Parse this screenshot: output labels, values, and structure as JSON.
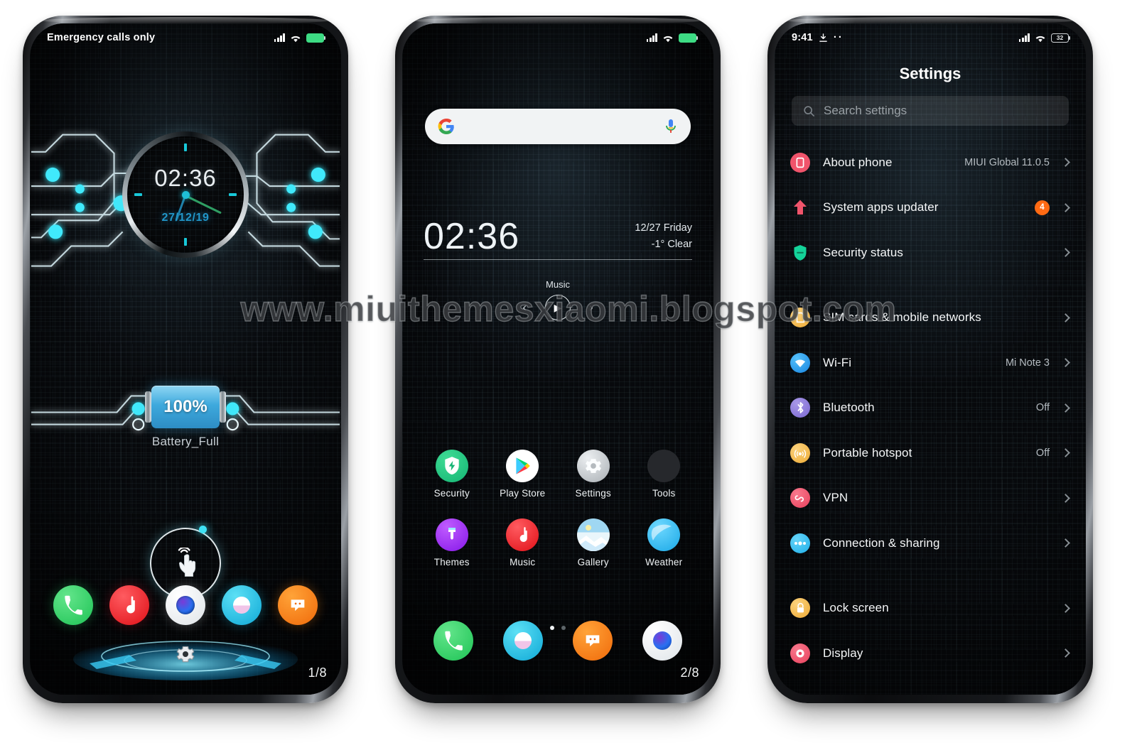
{
  "watermark": "www.miuithemesxiaomi.blogspot.com",
  "phone1": {
    "name": "lock-screen",
    "status": {
      "carrier": "Emergency calls only"
    },
    "clock": {
      "time": "02:36",
      "date": "27/12/19"
    },
    "battery_widget": {
      "value": "100%",
      "label": "Battery_Full"
    },
    "unlock_hint_icon": "tap-hand-icon",
    "dock": [
      {
        "label": "Phone",
        "icon": "phone-icon",
        "color": "#2fcf62"
      },
      {
        "label": "Music",
        "icon": "music-note-icon",
        "color": "#ee1d25"
      },
      {
        "label": "Camera",
        "icon": "camera-lens-icon",
        "color": "#ffffff"
      },
      {
        "label": "Mi Browser",
        "icon": "browser-icon",
        "color": "#23c4e8"
      },
      {
        "label": "Messages",
        "icon": "message-icon",
        "color": "#f57c1f"
      }
    ],
    "settings_gear_icon": "gear-icon",
    "page": "1/8"
  },
  "phone2": {
    "name": "home-screen",
    "search": {
      "placeholder": "",
      "left_icon": "google-g-icon",
      "right_icon": "microphone-icon"
    },
    "clock": {
      "time": "02:36",
      "date": "12/27  Friday",
      "weather": "-1° Clear"
    },
    "music": {
      "title": "Music",
      "prev_icon": "chevron-left-icon",
      "play_icon": "play-icon",
      "next_icon": "chevron-right-icon"
    },
    "apps": [
      {
        "label": "Security",
        "icon": "shield-bolt-icon",
        "color": "#1fc07a"
      },
      {
        "label": "Play Store",
        "icon": "play-store-icon",
        "color": "#ffffff"
      },
      {
        "label": "Settings",
        "icon": "gear-icon",
        "color": "#c8ccd0"
      },
      {
        "label": "Tools",
        "icon": "folder-grid-icon",
        "color": "#1a1c1f"
      },
      {
        "label": "Themes",
        "icon": "paintbrush-icon",
        "color": "#9b2ff5"
      },
      {
        "label": "Music",
        "icon": "music-note-icon",
        "color": "#ee1d25"
      },
      {
        "label": "Gallery",
        "icon": "landscape-icon",
        "color": "#bfe3f5"
      },
      {
        "label": "Weather",
        "icon": "weather-icon",
        "color": "#39c0ef"
      }
    ],
    "page_dots": {
      "count": 2,
      "active": 0
    },
    "dock": [
      {
        "label": "Phone",
        "icon": "phone-icon",
        "color": "#2fcf62"
      },
      {
        "label": "Mi Browser",
        "icon": "browser-icon",
        "color": "#23c4e8"
      },
      {
        "label": "Messages",
        "icon": "message-icon",
        "color": "#f57c1f"
      },
      {
        "label": "Camera",
        "icon": "camera-lens-icon",
        "color": "#ffffff"
      }
    ],
    "page": "2/8"
  },
  "phone3": {
    "name": "settings-screen",
    "status": {
      "time": "9:41",
      "download_icon": "download-icon",
      "dots_icon": "more-dots-icon",
      "battery": "32"
    },
    "title": "Settings",
    "search": {
      "placeholder": "Search settings",
      "icon": "search-icon"
    },
    "items": [
      {
        "label": "About phone",
        "value": "MIUI Global 11.0.5",
        "badge": "",
        "icon": "phone-outline-icon",
        "color": "#f0546b"
      },
      {
        "label": "System apps updater",
        "value": "",
        "badge": "4",
        "icon": "up-arrow-icon",
        "color": "#f0546b"
      },
      {
        "label": "Security status",
        "value": "",
        "badge": "",
        "icon": "shield-icon",
        "color": "#14d39a"
      },
      {
        "gap": true
      },
      {
        "label": "SIM cards & mobile networks",
        "value": "",
        "badge": "",
        "icon": "sim-card-icon",
        "color": "#f5b942"
      },
      {
        "label": "Wi-Fi",
        "value": "Mi Note 3",
        "badge": "",
        "icon": "wifi-icon",
        "color": "#2196f3"
      },
      {
        "label": "Bluetooth",
        "value": "Off",
        "badge": "",
        "icon": "bluetooth-icon",
        "color": "#8e7cdc"
      },
      {
        "label": "Portable hotspot",
        "value": "Off",
        "badge": "",
        "icon": "hotspot-icon",
        "color": "#f5b942"
      },
      {
        "label": "VPN",
        "value": "",
        "badge": "",
        "icon": "vpn-icon",
        "color": "#f0546b"
      },
      {
        "label": "Connection & sharing",
        "value": "",
        "badge": "",
        "icon": "connection-icon",
        "color": "#2bb7f0"
      },
      {
        "gap": true
      },
      {
        "label": "Lock screen",
        "value": "",
        "badge": "",
        "icon": "lock-icon",
        "color": "#f5b942"
      },
      {
        "label": "Display",
        "value": "",
        "badge": "",
        "icon": "display-icon",
        "color": "#f0546b"
      }
    ]
  }
}
